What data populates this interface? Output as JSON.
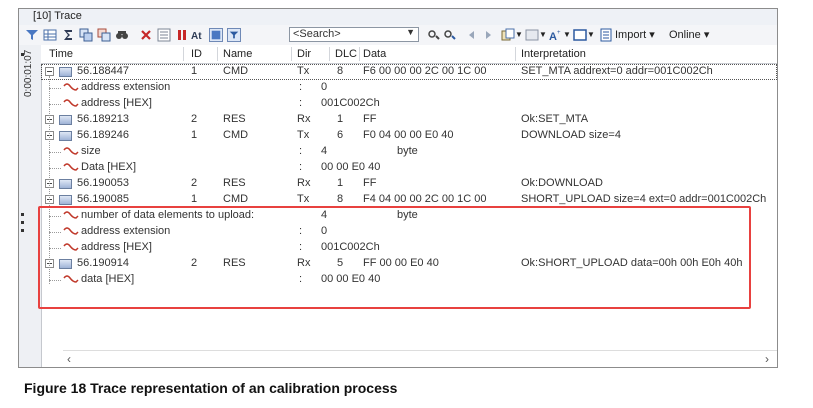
{
  "window": {
    "title": "[10] Trace"
  },
  "toolbar": {
    "search_placeholder": "<Search>",
    "import_label": "Import",
    "online_label": "Online"
  },
  "sidestrip": {
    "time_label": "0:00:01:07"
  },
  "columns": [
    "Time",
    "ID",
    "Name",
    "Dir",
    "DLC",
    "Data",
    "Interpretation"
  ],
  "rows": [
    {
      "kind": "msg",
      "time": "56.188447",
      "id": "1",
      "name": "CMD",
      "dir": "Tx",
      "dlc": "8",
      "data": "F6  00  00  00  2C  00  1C  00",
      "interp": "SET_MTA addrext=0 addr=001C002Ch"
    },
    {
      "kind": "sig",
      "name": "address extension",
      "sep": ":",
      "value": "0",
      "unit": ""
    },
    {
      "kind": "sig",
      "name": "address [HEX]",
      "sep": ":",
      "value": "001C002Ch",
      "unit": ""
    },
    {
      "kind": "msg",
      "time": "56.189213",
      "id": "2",
      "name": "RES",
      "dir": "Rx",
      "dlc": "1",
      "data": "FF",
      "interp": "Ok:SET_MTA"
    },
    {
      "kind": "msg",
      "time": "56.189246",
      "id": "1",
      "name": "CMD",
      "dir": "Tx",
      "dlc": "6",
      "data": "F0  04  00  00  E0  40",
      "interp": "DOWNLOAD size=4"
    },
    {
      "kind": "sig",
      "name": "size",
      "sep": ":",
      "value": "4",
      "unit": "byte"
    },
    {
      "kind": "sig",
      "name": "Data [HEX]",
      "sep": ":",
      "value": "00 00 E0 40",
      "unit": ""
    },
    {
      "kind": "msg",
      "time": "56.190053",
      "id": "2",
      "name": "RES",
      "dir": "Rx",
      "dlc": "1",
      "data": "FF",
      "interp": "Ok:DOWNLOAD"
    },
    {
      "kind": "msg",
      "time": "56.190085",
      "id": "1",
      "name": "CMD",
      "dir": "Tx",
      "dlc": "8",
      "data": "F4  04  00  00  2C  00  1C  00",
      "interp": "SHORT_UPLOAD size=4 ext=0 addr=001C002Ch"
    },
    {
      "kind": "sig",
      "name": "number of data elements to upload:",
      "sep": "",
      "value": "4",
      "unit": "byte"
    },
    {
      "kind": "sig",
      "name": "address extension",
      "sep": ":",
      "value": "0",
      "unit": ""
    },
    {
      "kind": "sig",
      "name": "address [HEX]",
      "sep": ":",
      "value": "001C002Ch",
      "unit": ""
    },
    {
      "kind": "msg",
      "time": "56.190914",
      "id": "2",
      "name": "RES",
      "dir": "Rx",
      "dlc": "5",
      "data": "FF  00  00  E0  40",
      "interp": "Ok:SHORT_UPLOAD data=00h 00h E0h 40h"
    },
    {
      "kind": "sig",
      "name": "data [HEX]",
      "sep": ":",
      "value": "00 00 E0 40",
      "unit": ""
    }
  ],
  "caption": "Figure 18 Trace representation of an calibration process"
}
